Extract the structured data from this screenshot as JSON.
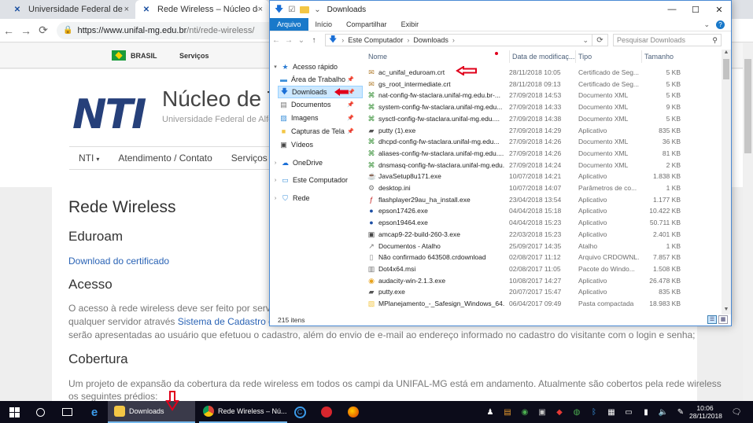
{
  "browser": {
    "tabs": [
      {
        "title": "Universidade Federal de Alfenas",
        "close": "×"
      },
      {
        "title": "Rede Wireless – Núcleo de Tecno",
        "close": "×"
      }
    ],
    "nav": {
      "back": "←",
      "forward": "→",
      "reload": "⟳"
    },
    "url_host": "https://www.unifal-mg.edu.br",
    "url_path": "/nti/rede-wireless/"
  },
  "webpage": {
    "govbar": {
      "brasil": "BRASIL",
      "servicos": "Serviços"
    },
    "logo": "NTI",
    "site_title": "Núcleo de T",
    "site_subtitle": "Universidade Federal de Alfe",
    "menu": [
      "NTI",
      "Atendimento / Contato",
      "Serviços"
    ],
    "caret": "▾",
    "heading": "Rede Wireless",
    "section1": "Eduroam",
    "link_certificate": "Download do certificado",
    "section2": "Acesso",
    "access_p1": "O acesso à rede wireless deve ser feito por servidore",
    "access_p2a": "qualquer servidor através ",
    "access_p2_link": "Sistema de Cadastro de Vi",
    "access_p3": "serão apresentadas ao usuário que efetuou o cadastro, além do envio de e-mail ao endereço informado no cadastro do visitante com o login e senha;",
    "section3": "Cobertura",
    "coverage_p1": "Um projeto de expansão da cobertura da rede wireless em todos os campi da UNIFAL-MG está em andamento. Atualmente são cobertos pela rede wireless",
    "coverage_p2": "os seguintes prédios:"
  },
  "explorer": {
    "title": "Downloads",
    "window_buttons": {
      "minimize": "—",
      "maximize": "☐",
      "close": "✕"
    },
    "ribbon": {
      "file": "Arquivo",
      "tabs": [
        "Início",
        "Compartilhar",
        "Exibir"
      ],
      "expand": "⌄",
      "help": "?"
    },
    "address": {
      "back": "←",
      "forward": "→",
      "recent": "⌄",
      "up": "↑",
      "arrow": "🡇",
      "crumbs": [
        "Este Computador",
        "Downloads"
      ],
      "crumb_sep": "›",
      "dropdown": "⌄",
      "refresh": "⟳"
    },
    "search_placeholder": "Pesquisar Downloads",
    "search_icon": "search-icon",
    "navpane": [
      {
        "label": "Acesso rápido",
        "icon": "star-icon",
        "color": "#2b7cd3",
        "pinned": false,
        "expander": "▾"
      },
      {
        "label": "Área de Trabalho",
        "icon": "desktop-icon",
        "color": "#3a8fd9",
        "pinned": true
      },
      {
        "label": "Downloads",
        "icon": "download-arrow-icon",
        "color": "#1a6fd6",
        "pinned": true,
        "selected": true
      },
      {
        "label": "Documentos",
        "icon": "documents-icon",
        "color": "#777",
        "pinned": true
      },
      {
        "label": "Imagens",
        "icon": "pictures-icon",
        "color": "#3a8fd9",
        "pinned": true
      },
      {
        "label": "Capturas de Tela",
        "icon": "folder-icon",
        "color": "#f3c645",
        "pinned": true
      },
      {
        "label": "Vídeos",
        "icon": "videos-icon",
        "color": "#444",
        "pinned": false
      },
      {
        "label": "OneDrive",
        "icon": "cloud-icon",
        "color": "#1a6fd6",
        "pinned": false,
        "expander": "›"
      },
      {
        "label": "Este Computador",
        "icon": "computer-icon",
        "color": "#3a8fd9",
        "pinned": false,
        "expander": "›"
      },
      {
        "label": "Rede",
        "icon": "network-icon",
        "color": "#3a8fd9",
        "pinned": false,
        "expander": "›"
      }
    ],
    "pin_glyph": "📌",
    "columns": {
      "name": "Nome",
      "date": "Data de modificaç...",
      "type": "Tipo",
      "size": "Tamanho"
    },
    "files": [
      {
        "name": "ac_unifal_eduroam.crt",
        "date": "28/11/2018 10:05",
        "type": "Certificado de Seg...",
        "size": "5 KB",
        "icon": "certificate-icon",
        "color": "#b07a2a"
      },
      {
        "name": "gs_root_intermediate.crt",
        "date": "28/11/2018 09:13",
        "type": "Certificado de Seg...",
        "size": "5 KB",
        "icon": "certificate-icon",
        "color": "#b07a2a"
      },
      {
        "name": "nat-config-fw-staclara.unifal-mg.edu.br-...",
        "date": "27/09/2018 14:53",
        "type": "Documento XML",
        "size": "5 KB",
        "icon": "xml-icon",
        "color": "#2c8a2c"
      },
      {
        "name": "system-config-fw-staclara.unifal-mg.edu...",
        "date": "27/09/2018 14:33",
        "type": "Documento XML",
        "size": "9 KB",
        "icon": "xml-icon",
        "color": "#2c8a2c"
      },
      {
        "name": "sysctl-config-fw-staclara.unifal-mg.edu....",
        "date": "27/09/2018 14:38",
        "type": "Documento XML",
        "size": "5 KB",
        "icon": "xml-icon",
        "color": "#2c8a2c"
      },
      {
        "name": "putty (1).exe",
        "date": "27/09/2018 14:29",
        "type": "Aplicativo",
        "size": "835 KB",
        "icon": "putty-icon",
        "color": "#555"
      },
      {
        "name": "dhcpd-config-fw-staclara.unifal-mg.edu...",
        "date": "27/09/2018 14:26",
        "type": "Documento XML",
        "size": "36 KB",
        "icon": "xml-icon",
        "color": "#2c8a2c"
      },
      {
        "name": "aliases-config-fw-staclara.unifal-mg.edu....",
        "date": "27/09/2018 14:26",
        "type": "Documento XML",
        "size": "81 KB",
        "icon": "xml-icon",
        "color": "#2c8a2c"
      },
      {
        "name": "dnsmasq-config-fw-staclara.unifal-mg.edu...",
        "date": "27/09/2018 14:24",
        "type": "Documento XML",
        "size": "2 KB",
        "icon": "xml-icon",
        "color": "#2c8a2c"
      },
      {
        "name": "JavaSetup8u171.exe",
        "date": "10/07/2018 14:21",
        "type": "Aplicativo",
        "size": "1.838 KB",
        "icon": "java-icon",
        "color": "#d5461b"
      },
      {
        "name": "desktop.ini",
        "date": "10/07/2018 14:07",
        "type": "Parâmetros de co...",
        "size": "1 KB",
        "icon": "settings-file-icon",
        "color": "#777"
      },
      {
        "name": "flashplayer29au_ha_install.exe",
        "date": "23/04/2018 13:54",
        "type": "Aplicativo",
        "size": "1.177 KB",
        "icon": "flash-icon",
        "color": "#c41e1e"
      },
      {
        "name": "epson17426.exe",
        "date": "04/04/2018 15:18",
        "type": "Aplicativo",
        "size": "10.422 KB",
        "icon": "epson-icon",
        "color": "#1d4fa5"
      },
      {
        "name": "epson19464.exe",
        "date": "04/04/2018 15:23",
        "type": "Aplicativo",
        "size": "50.711 KB",
        "icon": "epson-icon",
        "color": "#1d4fa5"
      },
      {
        "name": "amcap9-22-build-260-3.exe",
        "date": "22/03/2018 15:23",
        "type": "Aplicativo",
        "size": "2.401 KB",
        "icon": "app-icon",
        "color": "#444"
      },
      {
        "name": "Documentos - Atalho",
        "date": "25/09/2017 14:35",
        "type": "Atalho",
        "size": "1 KB",
        "icon": "shortcut-icon",
        "color": "#777"
      },
      {
        "name": "Não confirmado 643508.crdownload",
        "date": "02/08/2017 11:12",
        "type": "Arquivo CRDOWNL...",
        "size": "7.857 KB",
        "icon": "file-icon",
        "color": "#888"
      },
      {
        "name": "Dot4x64.msi",
        "date": "02/08/2017 11:05",
        "type": "Pacote do Windo...",
        "size": "1.508 KB",
        "icon": "installer-icon",
        "color": "#777"
      },
      {
        "name": "audacity-win-2.1.3.exe",
        "date": "10/08/2017 14:27",
        "type": "Aplicativo",
        "size": "26.478 KB",
        "icon": "audacity-icon",
        "color": "#e8a21b"
      },
      {
        "name": "putty.exe",
        "date": "20/07/2017 15:47",
        "type": "Aplicativo",
        "size": "835 KB",
        "icon": "putty-icon",
        "color": "#555"
      },
      {
        "name": "MPlanejamento_-_Safesign_Windows_64...",
        "date": "06/04/2017 09:49",
        "type": "Pasta compactada",
        "size": "18.983 KB",
        "icon": "zip-folder-icon",
        "color": "#f3c645"
      }
    ],
    "status": "215 itens",
    "views": {
      "details": "☰",
      "tiles": "▦"
    }
  },
  "taskbar": {
    "task_explorer": "Downloads",
    "task_chrome": "Rede Wireless – Nú...",
    "clock_time": "10:06",
    "clock_date": "28/11/2018"
  },
  "annotation_color": "#e0001b"
}
